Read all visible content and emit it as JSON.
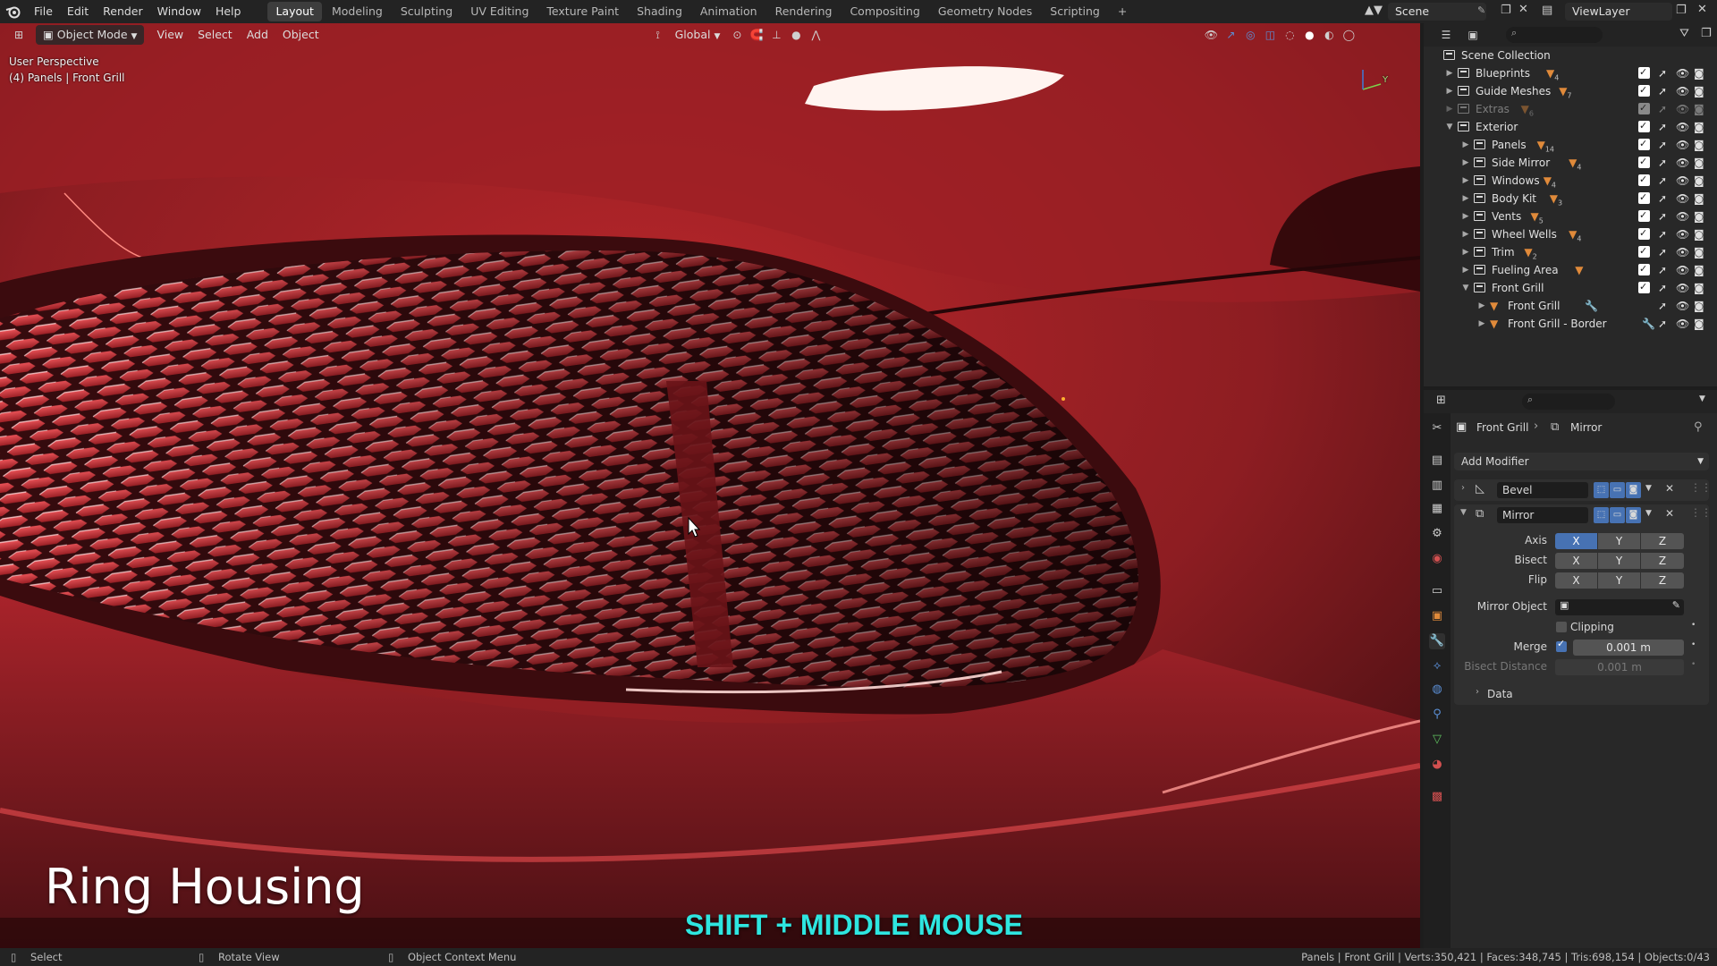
{
  "topbar": {
    "menus": [
      "File",
      "Edit",
      "Render",
      "Window",
      "Help"
    ],
    "workspaces": [
      "Layout",
      "Modeling",
      "Sculpting",
      "UV Editing",
      "Texture Paint",
      "Shading",
      "Animation",
      "Rendering",
      "Compositing",
      "Geometry Nodes",
      "Scripting",
      "+"
    ],
    "active_workspace": "Layout",
    "scene": "Scene",
    "view_layer": "ViewLayer"
  },
  "viewport_header": {
    "mode": "Object Mode",
    "menus": [
      "View",
      "Select",
      "Add",
      "Object"
    ],
    "transform_orientation": "Global"
  },
  "viewport": {
    "perspective_label": "User Perspective",
    "context_label": "(4) Panels | Front Grill",
    "caption_title": "Ring Housing",
    "shortcut_caption": "SHIFT + MIDDLE MOUSE",
    "axis_gizmo": {
      "y": "Y",
      "z": "Z"
    }
  },
  "outliner": {
    "root": "Scene Collection",
    "rows": [
      {
        "label": "Blueprints",
        "depth": 1,
        "badge": "4",
        "expanded": false,
        "dim": false
      },
      {
        "label": "Guide Meshes",
        "depth": 1,
        "badge": "7",
        "expanded": false,
        "dim": false
      },
      {
        "label": "Extras",
        "depth": 1,
        "badge": "6",
        "expanded": false,
        "dim": true
      },
      {
        "label": "Exterior",
        "depth": 1,
        "badge": "",
        "expanded": true,
        "dim": false
      },
      {
        "label": "Panels",
        "depth": 2,
        "badge": "14",
        "expanded": false,
        "dim": false
      },
      {
        "label": "Side Mirror",
        "depth": 2,
        "badge": "4",
        "expanded": false,
        "dim": false
      },
      {
        "label": "Windows",
        "depth": 2,
        "badge": "4",
        "expanded": false,
        "dim": false
      },
      {
        "label": "Body Kit",
        "depth": 2,
        "badge": "3",
        "expanded": false,
        "dim": false
      },
      {
        "label": "Vents",
        "depth": 2,
        "badge": "5",
        "expanded": false,
        "dim": false
      },
      {
        "label": "Wheel Wells",
        "depth": 2,
        "badge": "4",
        "expanded": false,
        "dim": false
      },
      {
        "label": "Trim",
        "depth": 2,
        "badge": "2",
        "expanded": false,
        "dim": false
      },
      {
        "label": "Fueling Area",
        "depth": 2,
        "badge": "",
        "expanded": false,
        "dim": false
      },
      {
        "label": "Front Grill",
        "depth": 2,
        "badge": "",
        "expanded": true,
        "dim": false
      },
      {
        "label": "Front Grill",
        "depth": 3,
        "badge": "",
        "expanded": false,
        "dim": false,
        "object": true
      },
      {
        "label": "Front Grill - Border",
        "depth": 3,
        "badge": "",
        "expanded": false,
        "dim": false,
        "object": true
      }
    ]
  },
  "properties": {
    "breadcrumb_object": "Front Grill",
    "breadcrumb_modifier": "Mirror",
    "add_modifier": "Add Modifier",
    "modifiers": [
      {
        "name": "Bevel",
        "expanded": false
      },
      {
        "name": "Mirror",
        "expanded": true
      }
    ],
    "mirror": {
      "axis_label": "Axis",
      "bisect_label": "Bisect",
      "flip_label": "Flip",
      "axes": [
        "X",
        "Y",
        "Z"
      ],
      "axis_active": "X",
      "mirror_object_label": "Mirror Object",
      "clipping_label": "Clipping",
      "merge_label": "Merge",
      "merge_value": "0.001 m",
      "bisect_distance_label": "Bisect Distance",
      "bisect_distance_value": "0.001 m",
      "data_label": "Data"
    }
  },
  "statusbar": {
    "left": [
      "Select",
      "Rotate View",
      "Object Context Menu"
    ],
    "right": "Panels | Front Grill | Verts:350,421 | Faces:348,745 | Tris:698,154 | Objects:0/43"
  },
  "colors": {
    "accent": "#4772b3",
    "car_paint": "#b3262b",
    "shortcut_caption": "#2ee6e0"
  }
}
